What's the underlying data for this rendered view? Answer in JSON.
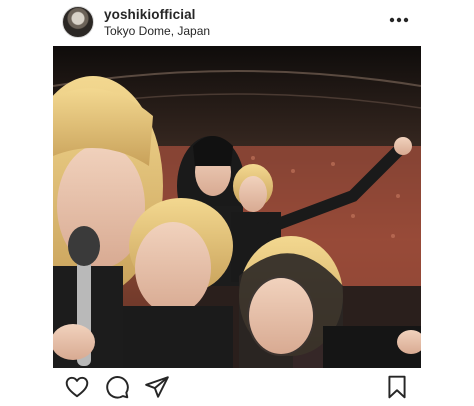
{
  "post": {
    "username": "yoshikiofficial",
    "location": "Tokyo Dome, Japan"
  },
  "icons": {
    "avatar": "avatar",
    "more": "more-options-icon",
    "like": "heart-icon",
    "comment": "comment-icon",
    "share": "send-icon",
    "save": "bookmark-icon"
  },
  "colors": {
    "text": "#262626",
    "border": "#dbdbdb",
    "background": "#ffffff"
  }
}
